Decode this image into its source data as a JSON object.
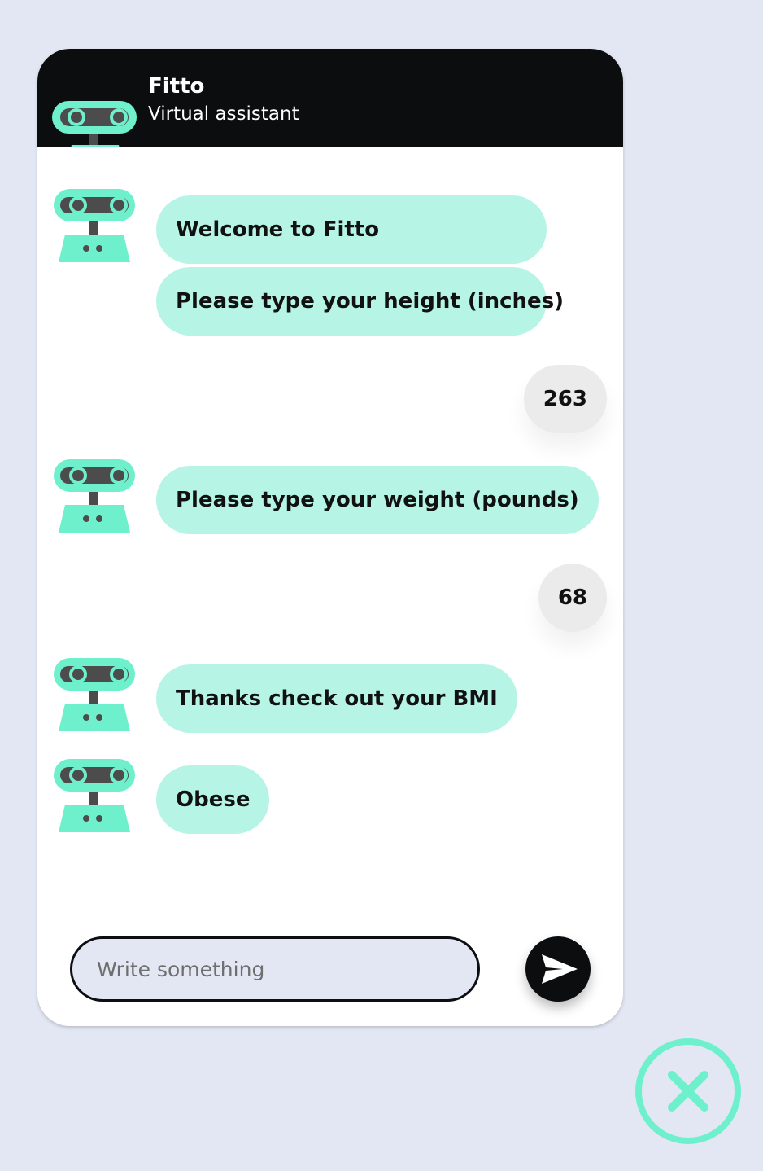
{
  "header": {
    "title": "Fitto",
    "subtitle": "Virtual assistant"
  },
  "messages": [
    {
      "sender": "bot",
      "text": "Welcome to Fitto"
    },
    {
      "sender": "bot",
      "text": "Please type your height (inches)"
    },
    {
      "sender": "user",
      "text": "263"
    },
    {
      "sender": "bot",
      "text": "Please type your weight (pounds)"
    },
    {
      "sender": "user",
      "text": "68"
    },
    {
      "sender": "bot",
      "text": "Thanks check out your BMI"
    },
    {
      "sender": "bot",
      "text": "Obese"
    }
  ],
  "composer": {
    "placeholder": "Write something",
    "value": ""
  },
  "icons": {
    "bot_avatar": "robot-icon",
    "send": "send-icon",
    "close": "close-icon"
  },
  "colors": {
    "background": "#e2e7f3",
    "header": "#0c0d0f",
    "bot_bubble": "#b6f5e6",
    "user_bubble": "#ebebeb",
    "accent": "#6ef0cd"
  }
}
